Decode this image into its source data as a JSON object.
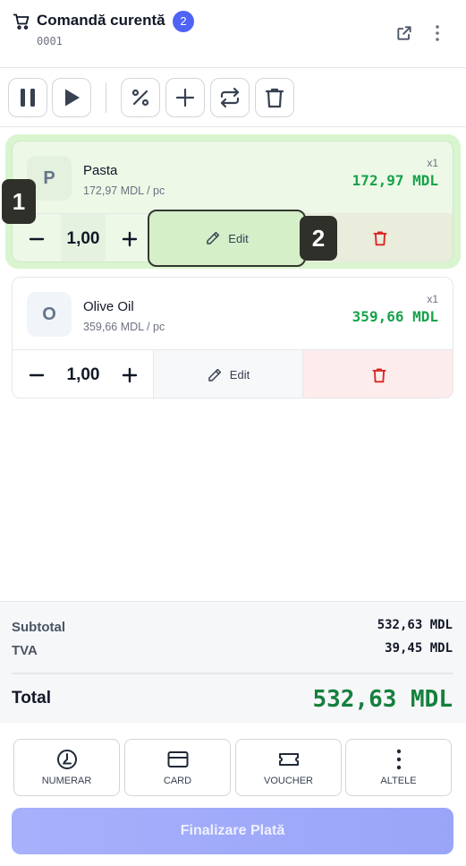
{
  "header": {
    "title": "Comandă curentă",
    "badge": "2",
    "order_number": "0001",
    "icons": [
      "cart-icon",
      "external-link-icon",
      "more-vertical-icon"
    ]
  },
  "toolbar": {
    "buttons": [
      "pause-icon",
      "play-icon",
      "percent-icon",
      "plus-icon",
      "repeat-icon",
      "trash-icon"
    ]
  },
  "items": [
    {
      "initial": "P",
      "name": "Pasta",
      "unit_price": "172,97 MDL / pc",
      "multiplier": "x1",
      "price": "172,97 MDL",
      "quantity": "1,00",
      "edit_label": "Edit"
    },
    {
      "initial": "O",
      "name": "Olive Oil",
      "unit_price": "359,66 MDL / pc",
      "multiplier": "x1",
      "price": "359,66 MDL",
      "quantity": "1,00",
      "edit_label": "Edit"
    }
  ],
  "markers": [
    "1",
    "2"
  ],
  "summary": {
    "subtotal_label": "Subtotal",
    "subtotal_value": "532,63 MDL",
    "tva_label": "TVA",
    "tva_value": "39,45 MDL",
    "total_label": "Total",
    "total_value": "532,63 MDL"
  },
  "payment_methods": [
    {
      "label": "NUMERAR",
      "icon": "cash-clock-icon"
    },
    {
      "label": "CARD",
      "icon": "card-icon"
    },
    {
      "label": "VOUCHER",
      "icon": "ticket-icon"
    },
    {
      "label": "ALTELE",
      "icon": "more-vertical-icon"
    }
  ],
  "finalize_label": "Finalizare Plată",
  "colors": {
    "accent": "#4f63f5",
    "price_green": "#16a34a",
    "delete_red": "#dc2626",
    "selected_bg": "#d9f5cf"
  }
}
